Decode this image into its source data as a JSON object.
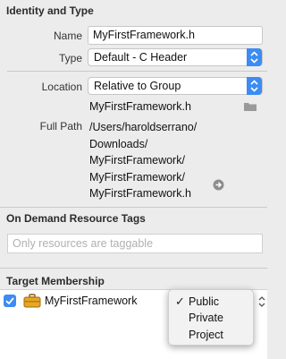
{
  "identity": {
    "title": "Identity and Type",
    "name_label": "Name",
    "name_value": "MyFirstFramework.h",
    "type_label": "Type",
    "type_value": "Default - C Header",
    "location_label": "Location",
    "location_value": "Relative to Group",
    "location_file": "MyFirstFramework.h",
    "fullpath_label": "Full Path",
    "fullpath_lines": [
      "/Users/haroldserrano/",
      "Downloads/",
      "MyFirstFramework/",
      "MyFirstFramework/",
      "MyFirstFramework.h"
    ]
  },
  "tags": {
    "title": "On Demand Resource Tags",
    "placeholder": "Only resources are taggable"
  },
  "membership": {
    "title": "Target Membership",
    "target_name": "MyFirstFramework",
    "checked": true
  },
  "menu": {
    "items": [
      "Public",
      "Private",
      "Project"
    ],
    "selected_index": 0,
    "checkmark": "✓"
  },
  "colors": {
    "accent": "#3c8cf1",
    "panel": "#ececec"
  }
}
